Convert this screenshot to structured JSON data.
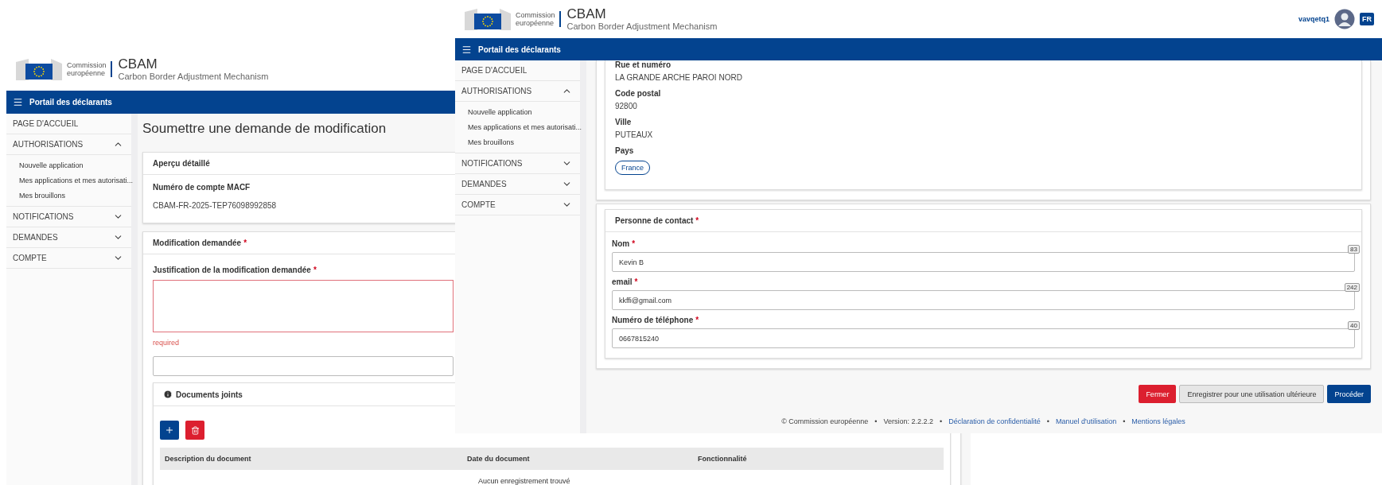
{
  "back_window": {
    "header": {
      "org": [
        "Commission",
        "européenne"
      ],
      "app_title": "CBAM",
      "app_subtitle": "Carbon Border Adjustment Mechanism",
      "nav_title": "Portail des déclarants"
    },
    "sidebar": [
      {
        "label": "PAGE D'ACCUEIL",
        "kind": "link"
      },
      {
        "label": "AUTHORISATIONS",
        "kind": "group",
        "expanded": true,
        "children": [
          {
            "label": "Nouvelle application"
          },
          {
            "label": "Mes applications et mes autorisati..."
          },
          {
            "label": "Mes brouillons"
          }
        ]
      },
      {
        "label": "NOTIFICATIONS",
        "kind": "group",
        "expanded": false
      },
      {
        "label": "DEMANDES",
        "kind": "group",
        "expanded": false
      },
      {
        "label": "COMPTE",
        "kind": "group",
        "expanded": false
      }
    ],
    "page_title": "Soumettre une demande de modification",
    "overview_card": {
      "title": "Aperçu détaillé",
      "field_label": "Numéro de compte MACF",
      "field_value": "CBAM-FR-2025-TEP76098992858"
    },
    "modification_card": {
      "title": "Modification demandée",
      "required_mark": "*",
      "justification_label": "Justification de la modification demandée",
      "justification_required_mark": "*",
      "error": "required"
    },
    "documents": {
      "title": "Documents joints",
      "columns": [
        "Description du document",
        "Date du document",
        "Fonctionnalité"
      ],
      "empty_message": "Aucun enregistrement trouvé"
    }
  },
  "front_window": {
    "header": {
      "org": [
        "Commission",
        "européenne"
      ],
      "app_title": "CBAM",
      "app_subtitle": "Carbon Border Adjustment Mechanism",
      "nav_title": "Portail des déclarants",
      "user": "vavqetq1",
      "language": "FR"
    },
    "sidebar": [
      {
        "label": "PAGE D'ACCUEIL",
        "kind": "link"
      },
      {
        "label": "AUTHORISATIONS",
        "kind": "group",
        "expanded": true,
        "children": [
          {
            "label": "Nouvelle application"
          },
          {
            "label": "Mes applications et mes autorisati..."
          },
          {
            "label": "Mes brouillons"
          }
        ]
      },
      {
        "label": "NOTIFICATIONS",
        "kind": "group",
        "expanded": false
      },
      {
        "label": "DEMANDES",
        "kind": "group",
        "expanded": false
      },
      {
        "label": "COMPTE",
        "kind": "group",
        "expanded": false
      }
    ],
    "address_fields": [
      {
        "label": "Rue et numéro",
        "kind": "text",
        "value": "LA GRANDE ARCHE PAROI NORD"
      },
      {
        "label": "Code postal",
        "kind": "text",
        "value": "92800"
      },
      {
        "label": "Ville",
        "kind": "text",
        "value": "PUTEAUX"
      },
      {
        "label": "Pays",
        "kind": "chip",
        "value": "France"
      }
    ],
    "contact": {
      "title": "Personne de contact",
      "required_mark": "*",
      "fields": [
        {
          "label": "Nom",
          "required_mark": "*",
          "value": "Kevin B",
          "counter": "83"
        },
        {
          "label": "email",
          "required_mark": "*",
          "value": "kkffi@gmail.com",
          "counter": "242"
        },
        {
          "label": "Numéro de téléphone",
          "required_mark": "*",
          "value": "0667815240",
          "counter": "40"
        }
      ]
    },
    "actions": [
      {
        "label": "Fermer"
      },
      {
        "label": "Enregistrer pour une utilisation ultérieure"
      },
      {
        "label": "Procéder"
      }
    ],
    "footer": {
      "separator": "•",
      "items": [
        {
          "kind": "text",
          "text": "© Commission européenne"
        },
        {
          "kind": "text",
          "text": "Version: 2.2.2.2"
        },
        {
          "kind": "link",
          "text": "Déclaration de confidentialité"
        },
        {
          "kind": "link",
          "text": "Manuel d'utilisation"
        },
        {
          "kind": "link",
          "text": "Mentions légales"
        }
      ]
    }
  }
}
